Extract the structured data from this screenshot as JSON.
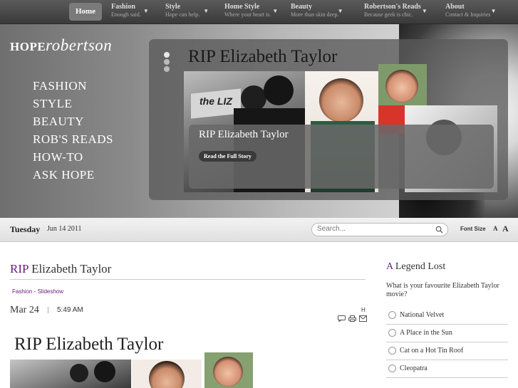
{
  "nav": {
    "home": "Home",
    "items": [
      {
        "title": "Fashion",
        "sub": "Enough said."
      },
      {
        "title": "Style",
        "sub": "Hope can help."
      },
      {
        "title": "Home Style",
        "sub": "Where your heart is."
      },
      {
        "title": "Beauty",
        "sub": "More than skin deep."
      },
      {
        "title": "Robertson's Reads",
        "sub": "Because geek is chic."
      },
      {
        "title": "About",
        "sub": "Contact & Inquiries"
      }
    ]
  },
  "logo": {
    "part1": "HOPE",
    "part2": "robertson"
  },
  "sidenav": [
    "FASHION",
    "STYLE",
    "BEAUTY",
    "ROB'S READS",
    "HOW-TO",
    "ASK HOPE"
  ],
  "featured": {
    "title": "RIP Elizabeth Taylor",
    "caption": "RIP Elizabeth Taylor",
    "button": "Read the Full Story",
    "photo_text": "the LIZ"
  },
  "datebar": {
    "day": "Tuesday",
    "date": "Jun 14 2011",
    "search_placeholder": "Search...",
    "font_size_label": "Font Size",
    "font_small": "A",
    "font_large": "A"
  },
  "article": {
    "title_prefix": "RIP",
    "title_rest": " Elizabeth Taylor",
    "breadcrumb": "Fashion - Slideshow",
    "date": "Mar 24",
    "time": "5:49 AM",
    "h_mark": "H",
    "body_title": "RIP Elizabeth Taylor"
  },
  "poll": {
    "title_prefix": "A",
    "title_rest": " Legend Lost",
    "question": "What is your favourite Elizabeth Taylor movie?",
    "options": [
      "National Velvet",
      "A Place in the Sun",
      "Cat on a Hot Tin Roof",
      "Cleopatra"
    ]
  },
  "colors": {
    "accent": "#6a1b7a",
    "nav_bg": "#454545"
  }
}
